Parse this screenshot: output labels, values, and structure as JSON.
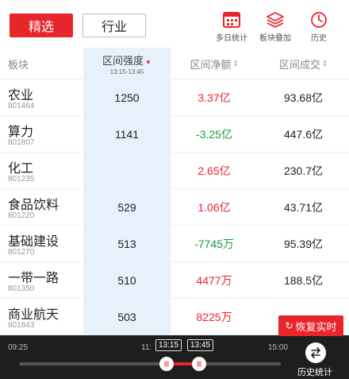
{
  "tabs": {
    "selected": "精选",
    "other": "行业"
  },
  "tools": {
    "multiday": "多日统计",
    "stack": "板块叠加",
    "history": "历史"
  },
  "header": {
    "name": "板块",
    "strength": "区间强度",
    "strength_range": "13:15-13:45",
    "net": "区间净额",
    "volume": "区间成交"
  },
  "colors": {
    "red": "#e8252b",
    "green": "#1a9a3a",
    "highlight": "#e6f1fb"
  },
  "rows": [
    {
      "name": "农业",
      "code": "801464",
      "strength": "1250",
      "net": "3.37亿",
      "net_dir": "up",
      "volume": "93.68亿"
    },
    {
      "name": "算力",
      "code": "801807",
      "strength": "1141",
      "net": "-3.25亿",
      "net_dir": "down",
      "volume": "447.6亿"
    },
    {
      "name": "化工",
      "code": "801235",
      "strength": "",
      "net": "2.65亿",
      "net_dir": "up",
      "volume": "230.7亿"
    },
    {
      "name": "食品饮料",
      "code": "801220",
      "strength": "529",
      "net": "1.06亿",
      "net_dir": "up",
      "volume": "43.71亿"
    },
    {
      "name": "基础建设",
      "code": "801270",
      "strength": "513",
      "net": "-7745万",
      "net_dir": "down",
      "volume": "95.39亿"
    },
    {
      "name": "一带一路",
      "code": "801350",
      "strength": "510",
      "net": "4477万",
      "net_dir": "up",
      "volume": "188.5亿"
    },
    {
      "name": "商业航天",
      "code": "801843",
      "strength": "503",
      "net": "8225万",
      "net_dir": "up",
      "volume": ""
    }
  ],
  "restore": "恢复实时",
  "timebar": {
    "start": "09:25",
    "mid": "11:",
    "end": "15:00",
    "range_start": "13:15",
    "range_end": "13:45",
    "history_label": "历史统计"
  }
}
